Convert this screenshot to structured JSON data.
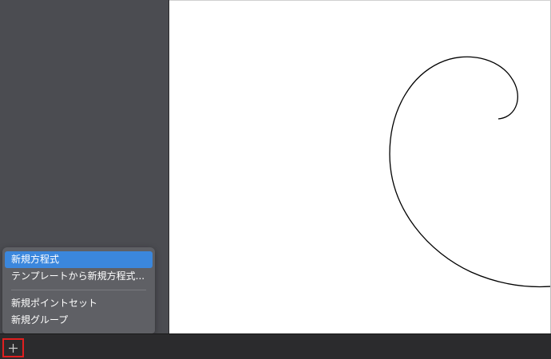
{
  "menu": {
    "items": [
      {
        "label": "新規方程式",
        "active": true
      },
      {
        "label": "テンプレートから新規方程式...",
        "active": false
      },
      {
        "label": "新規ポイントセット",
        "active": false
      },
      {
        "label": "新規グループ",
        "active": false
      }
    ]
  },
  "toolbar": {
    "add_icon": "plus-icon"
  },
  "colors": {
    "sidebar": "#4b4c51",
    "menu_bg": "#5f6065",
    "menu_highlight": "#3b87dd",
    "bottom_bar": "#2b2b2d",
    "focus_outline": "#e01f1f",
    "curve": "#000000"
  }
}
